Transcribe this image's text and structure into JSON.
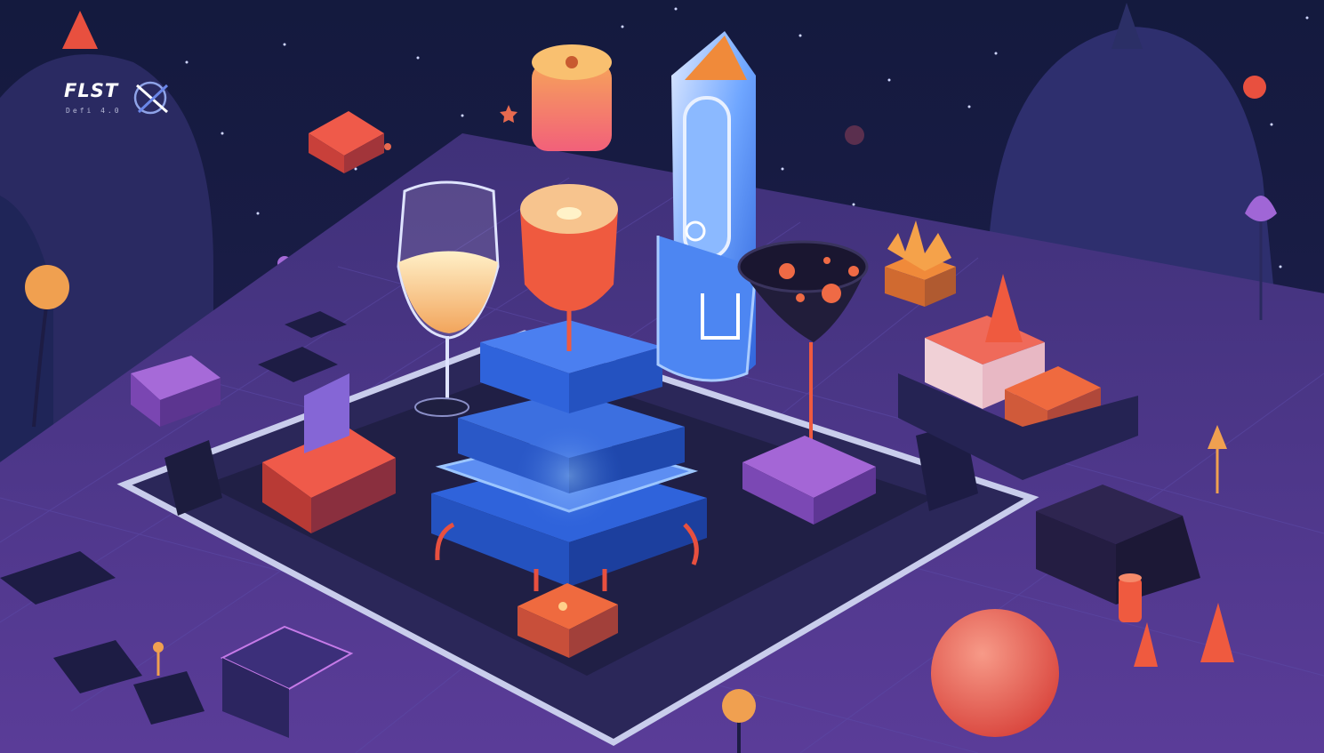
{
  "brand": {
    "title": "FLST",
    "subtitle": "Defi 4.0",
    "icon": "x-mark-icon"
  },
  "palette": {
    "sky": "#141a3e",
    "floor": "#4a3587",
    "platform_blue": "#3b6fe0",
    "accent_red": "#e8503f",
    "accent_orange": "#f07a3a",
    "accent_violet": "#a66ad8",
    "gold": "#f0a850"
  }
}
